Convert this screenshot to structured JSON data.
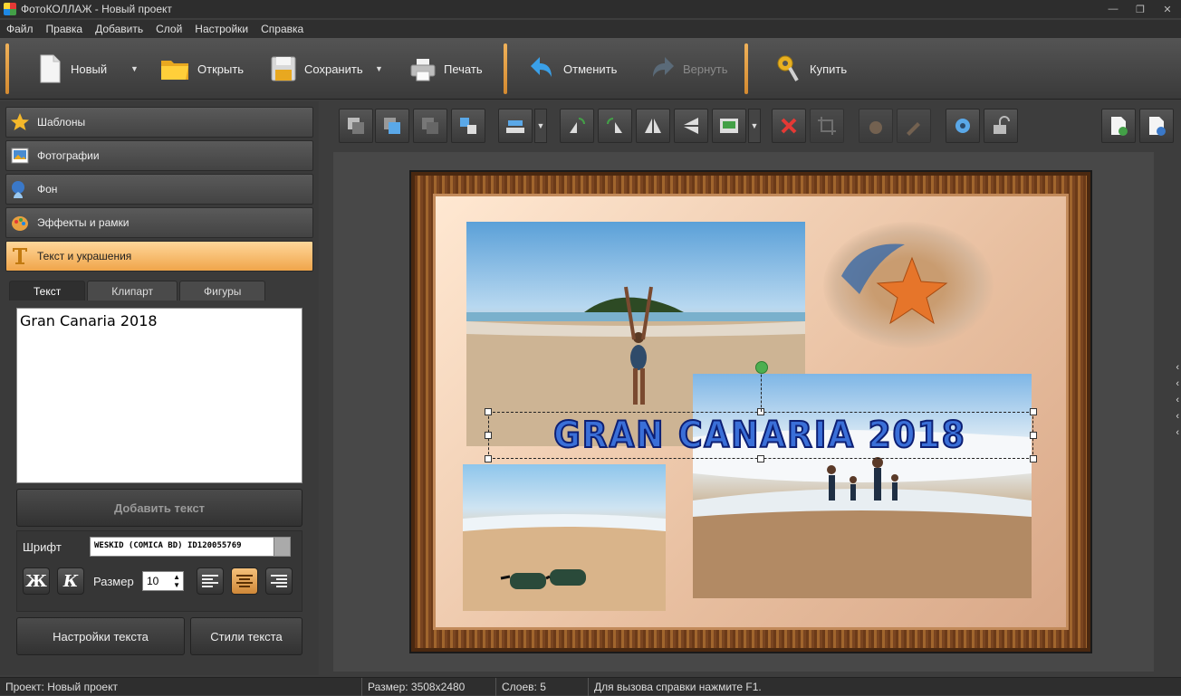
{
  "window": {
    "title": "ФотоКОЛЛАЖ - Новый проект"
  },
  "menu": [
    "Файл",
    "Правка",
    "Добавить",
    "Слой",
    "Настройки",
    "Справка"
  ],
  "toolbar": {
    "new_label": "Новый",
    "open_label": "Открыть",
    "save_label": "Сохранить",
    "print_label": "Печать",
    "undo_label": "Отменить",
    "redo_label": "Вернуть",
    "buy_label": "Купить"
  },
  "categories": [
    {
      "label": "Шаблоны",
      "icon": "star-icon"
    },
    {
      "label": "Фотографии",
      "icon": "photos-icon"
    },
    {
      "label": "Фон",
      "icon": "background-icon"
    },
    {
      "label": "Эффекты и рамки",
      "icon": "palette-icon"
    },
    {
      "label": "Текст и украшения",
      "icon": "text-icon",
      "active": true
    }
  ],
  "tabs": [
    "Текст",
    "Клипарт",
    "Фигуры"
  ],
  "text_panel": {
    "text_value": "Gran Canaria 2018",
    "add_text_label": "Добавить текст",
    "font_label": "Шрифт",
    "font_value": "WESKID (COMICA BD) ID120055769",
    "bold_label": "Ж",
    "italic_label": "К",
    "size_label": "Размер",
    "size_value": "10",
    "settings_label": "Настройки текста",
    "styles_label": "Стили текста"
  },
  "canvas": {
    "overlay_text": "GRAN CANARIA 2018",
    "colors": {
      "frame": "#7a4520",
      "mat": "#f0c8a8",
      "text_fill": "#3a6fd8",
      "text_stroke": "#0d1f73",
      "accent": "#f0a54a"
    }
  },
  "status": {
    "project": "Проект:  Новый проект",
    "size": "Размер:  3508x2480",
    "layers": "Слоев:  5",
    "hint": "Для вызова справки нажмите F1."
  }
}
